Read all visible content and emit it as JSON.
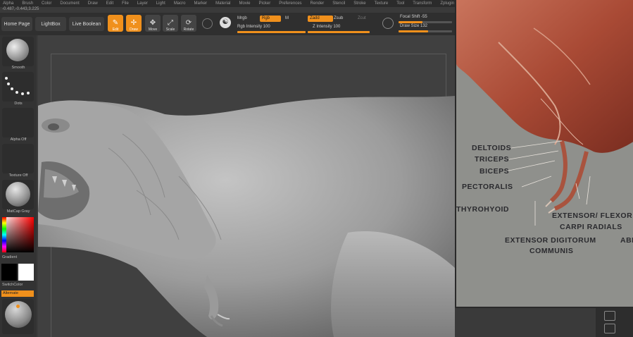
{
  "menu": {
    "items": [
      "Alpha",
      "Brush",
      "Color",
      "Document",
      "Draw",
      "Edit",
      "File",
      "Layer",
      "Light",
      "Macro",
      "Marker",
      "Material",
      "Movie",
      "Picker",
      "Preferences",
      "Render",
      "Stencil",
      "Stroke",
      "Texture",
      "Tool",
      "Transform",
      "Zplugin",
      "Zscript"
    ]
  },
  "coords_readout": "-0.487,-0.443,3.225",
  "toolbar": {
    "home_page": "Home Page",
    "lightbox": "LightBox",
    "live_boolean": "Live Boolean",
    "tools": [
      {
        "label": "Edit",
        "glyph": "✎",
        "active": true
      },
      {
        "label": "Draw",
        "glyph": "✢",
        "active": true
      },
      {
        "label": "Move",
        "glyph": "✥",
        "active": false
      },
      {
        "label": "Scale",
        "glyph": "⤢",
        "active": false
      },
      {
        "label": "Rotate",
        "glyph": "⟳",
        "active": false
      }
    ],
    "mrgb": "Mrgb",
    "rgb": "Rgb",
    "m": "M",
    "rgb_intensity": "Rgb Intensity 100",
    "zadd": "Zadd",
    "zsub": "Zsub",
    "zcut": "Zcut",
    "z_intensity": "Z Intensity 100",
    "focal_shift": "Focal Shift -55",
    "draw_size": "Draw Size 132"
  },
  "shelf": {
    "brush_label": "Smooth",
    "stroke_label": "Dots",
    "alpha_label": "Alpha Off",
    "texture_label": "Texture Off",
    "material_label": "MatCap Gray",
    "gradient_label": "Gradient",
    "switch_label": "SwitchColor",
    "alternate_label": "Alternate"
  },
  "inset": {
    "labels": {
      "deltoids": "DELTOIDS",
      "triceps": "TRICEPS",
      "biceps": "BICEPS",
      "pectoralis": "PECTORALIS",
      "thyrohyoid": "THYROHYOID",
      "extensor_flexor": "EXTENSOR/ FLEXOR",
      "carpi_radials": "CARPI RADIALS",
      "extensor_digitorum": "EXTENSOR DIGITORUM",
      "communis": "COMMUNIS",
      "abi": "ABI"
    }
  },
  "colors": {
    "accent": "#f0901c",
    "ui_dark": "#2f2f2f",
    "viewport": "#404040",
    "clay": "#a9a9a9",
    "muscle": "#b8553d"
  },
  "icons": [
    "edit-icon",
    "draw-icon",
    "move-icon",
    "scale-icon",
    "rotate-icon",
    "spotlight-icon",
    "lazy-mouse-icon"
  ]
}
